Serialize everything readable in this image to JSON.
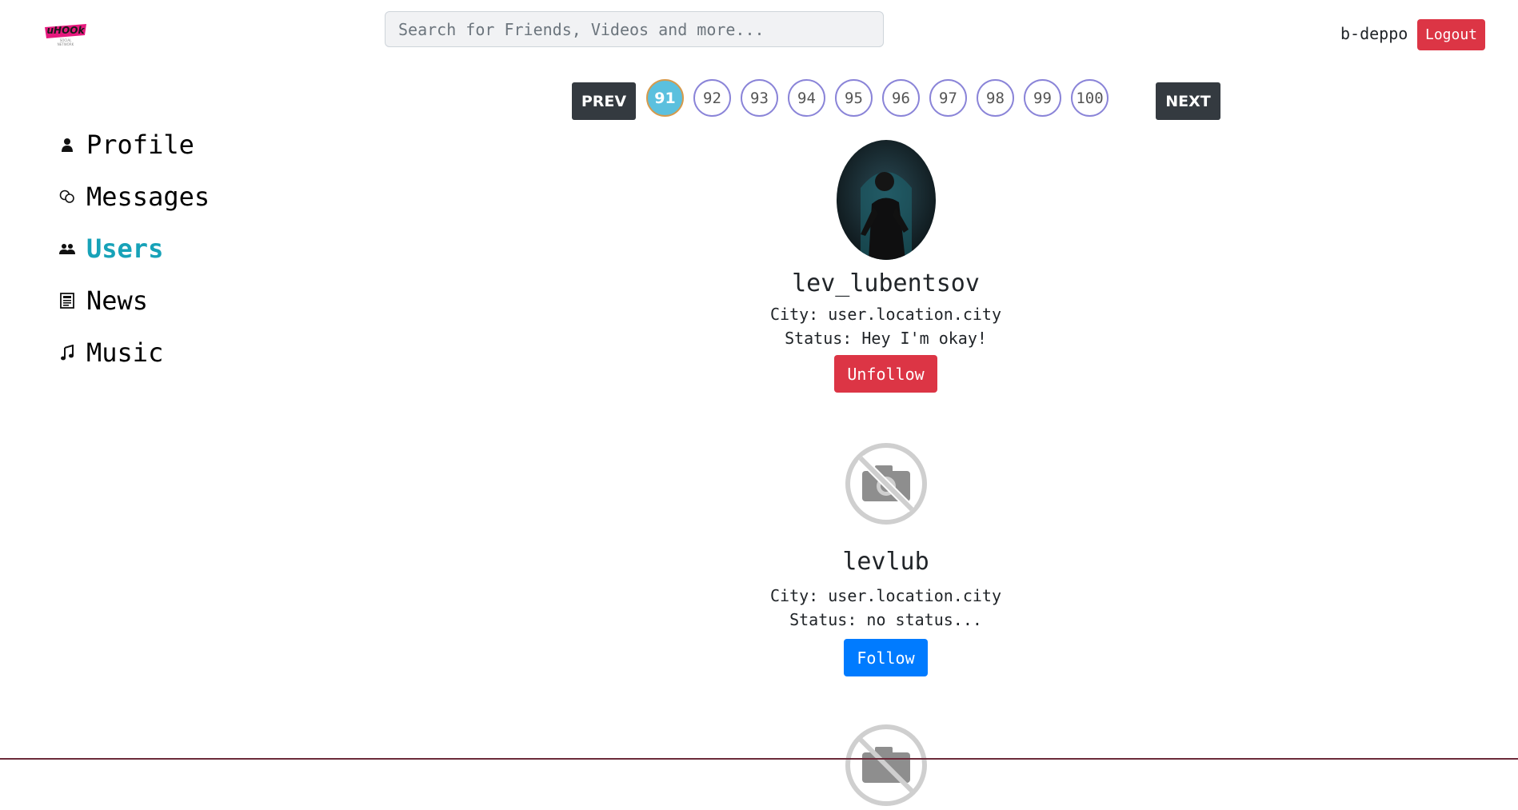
{
  "header": {
    "logo_text": "uHOOk",
    "search": {
      "placeholder": "Search for Friends, Videos and more...",
      "value": ""
    },
    "username": "b-deppo",
    "logout_label": "Logout"
  },
  "sidebar": {
    "items": [
      {
        "label": "Profile",
        "icon": "person-icon",
        "active": false
      },
      {
        "label": "Messages",
        "icon": "chat-bubbles-icon",
        "active": false
      },
      {
        "label": "Users",
        "icon": "people-icon",
        "active": true
      },
      {
        "label": "News",
        "icon": "newspaper-icon",
        "active": false
      },
      {
        "label": "Music",
        "icon": "music-note-icon",
        "active": false
      }
    ]
  },
  "pagination": {
    "prev_label": "PREV",
    "next_label": "NEXT",
    "pages": [
      "91",
      "92",
      "93",
      "94",
      "95",
      "96",
      "97",
      "98",
      "99",
      "100"
    ],
    "current": "91"
  },
  "users": [
    {
      "name": "lev_lubentsov",
      "city": "City: user.location.city",
      "status": "Status: Hey I'm okay!",
      "button_label": "Unfollow",
      "has_photo": true
    },
    {
      "name": "levlub",
      "city": "City: user.location.city",
      "status": "Status: no status...",
      "button_label": "Follow",
      "has_photo": false
    }
  ],
  "colors": {
    "active_nav": "#17a2b8",
    "danger": "#dc3545",
    "primary": "#007bff",
    "dark": "#343a40",
    "page_active": "#5bc0de"
  }
}
